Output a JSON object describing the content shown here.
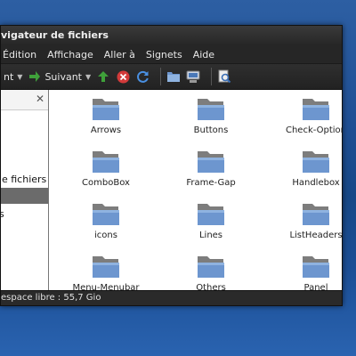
{
  "window": {
    "title": "vigateur de fichiers"
  },
  "menubar": {
    "items": [
      "Édition",
      "Affichage",
      "Aller à",
      "Signets",
      "Aide"
    ]
  },
  "toolbar": {
    "back_label": "nt",
    "forward_label": "Suivant",
    "icons": [
      "arrow-left-icon",
      "arrow-right-icon",
      "up-arrow-icon",
      "stop-icon",
      "reload-icon",
      "home-folder-icon",
      "computer-icon",
      "search-icon"
    ]
  },
  "sidebar": {
    "items": [
      {
        "label": "de fichiers"
      },
      {
        "label": ""
      },
      {
        "label": "s"
      }
    ]
  },
  "folders": [
    "Arrows",
    "Buttons",
    "Check-Option",
    "ComboBox",
    "Frame-Gap",
    "Handlebox",
    "icons",
    "Lines",
    "ListHeaders",
    "Menu-Menubar",
    "Others",
    "Panel"
  ],
  "statusbar": {
    "text": "espace libre : 55,7 Gio"
  },
  "colors": {
    "folder_body": "#6d96cf",
    "folder_back": "#7d7d7d",
    "accent_green": "#3fa13a"
  }
}
